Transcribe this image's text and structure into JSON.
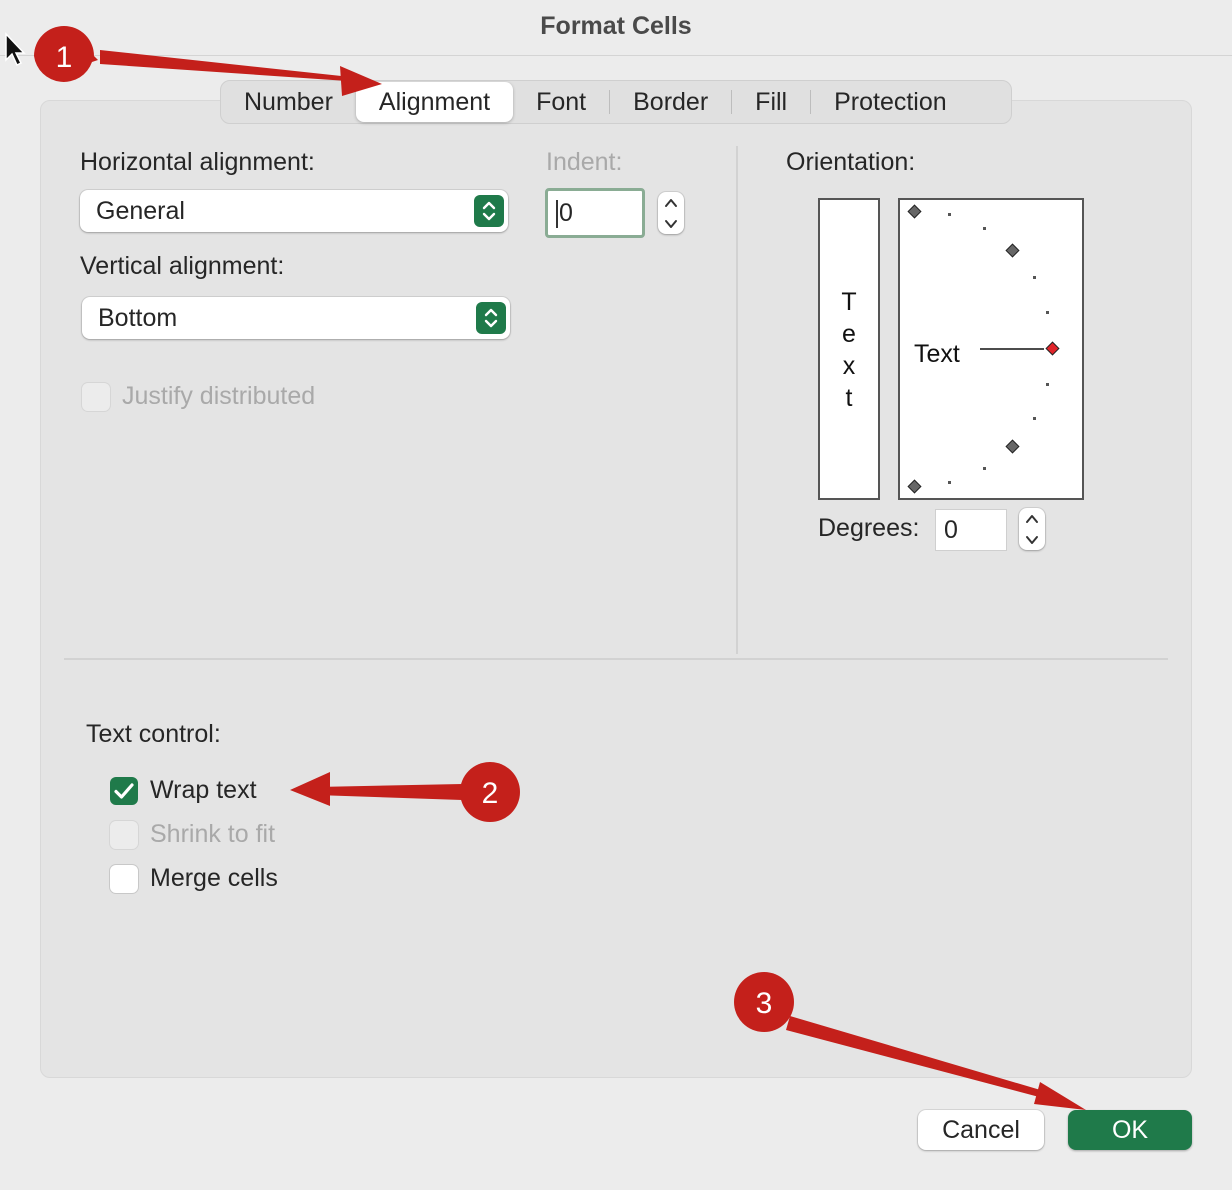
{
  "window": {
    "title": "Format Cells"
  },
  "tabs": [
    {
      "label": "Number",
      "selected": false
    },
    {
      "label": "Alignment",
      "selected": true
    },
    {
      "label": "Font",
      "selected": false
    },
    {
      "label": "Border",
      "selected": false
    },
    {
      "label": "Fill",
      "selected": false
    },
    {
      "label": "Protection",
      "selected": false
    }
  ],
  "alignment": {
    "horizontal_label": "Horizontal alignment:",
    "horizontal_value": "General",
    "vertical_label": "Vertical alignment:",
    "vertical_value": "Bottom",
    "indent_label": "Indent:",
    "indent_value": "0",
    "justify_distributed_label": "Justify distributed",
    "justify_distributed_checked": false,
    "justify_distributed_enabled": false
  },
  "orientation": {
    "label": "Orientation:",
    "vertical_text_letters": [
      "T",
      "e",
      "x",
      "t"
    ],
    "dial_text": "Text",
    "degrees_label": "Degrees:",
    "degrees_value": "0"
  },
  "text_control": {
    "label": "Text control:",
    "wrap_text_label": "Wrap text",
    "wrap_text_checked": true,
    "shrink_to_fit_label": "Shrink to fit",
    "shrink_to_fit_enabled": false,
    "merge_cells_label": "Merge cells",
    "merge_cells_checked": false
  },
  "buttons": {
    "cancel_label": "Cancel",
    "ok_label": "OK"
  },
  "annotations": {
    "callout_1": "1",
    "callout_2": "2",
    "callout_3": "3",
    "arrow_color": "#c4201b"
  },
  "colors": {
    "accent_green": "#1f7a4a",
    "dial_selected": "#e0242a"
  }
}
